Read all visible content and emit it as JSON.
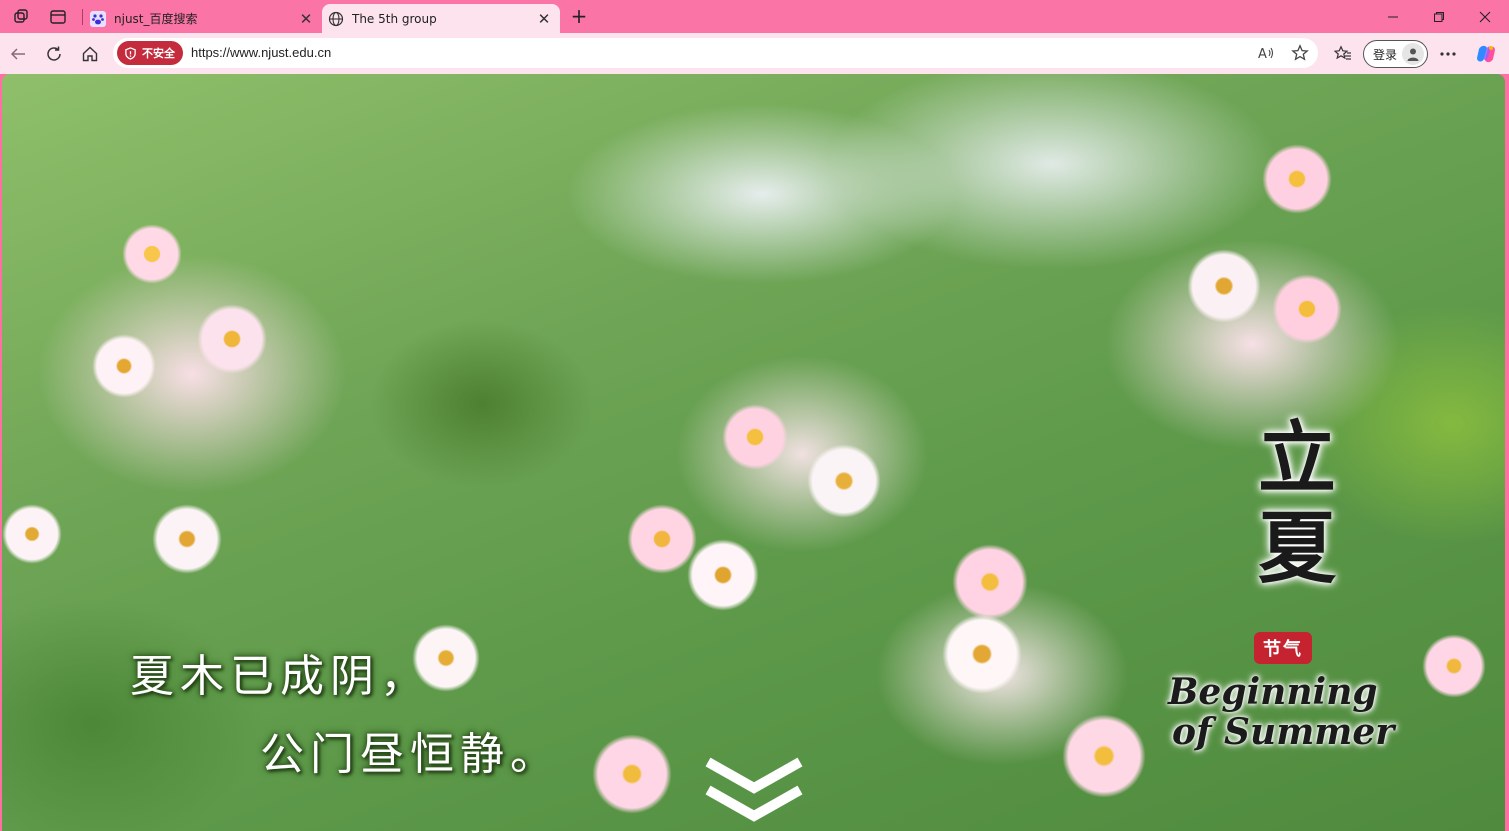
{
  "browser": {
    "tabs": [
      {
        "title": "njust_百度搜索",
        "active": false,
        "favicon": "baidu-paw-icon"
      },
      {
        "title": "The 5th group",
        "active": true,
        "favicon": "globe-icon"
      }
    ],
    "address": {
      "security_label": "不安全",
      "url": "https://www.njust.edu.cn"
    },
    "login_label": "登录",
    "accent_color": "#fb74a6"
  },
  "page": {
    "poem_line1": "夏木已成阴，",
    "poem_line2": "公门昼恒静。",
    "solar_term_char1": "立",
    "solar_term_char2": "夏",
    "badge_text": "节气",
    "english_line1": "Beginning",
    "english_line2": "of Summer"
  }
}
